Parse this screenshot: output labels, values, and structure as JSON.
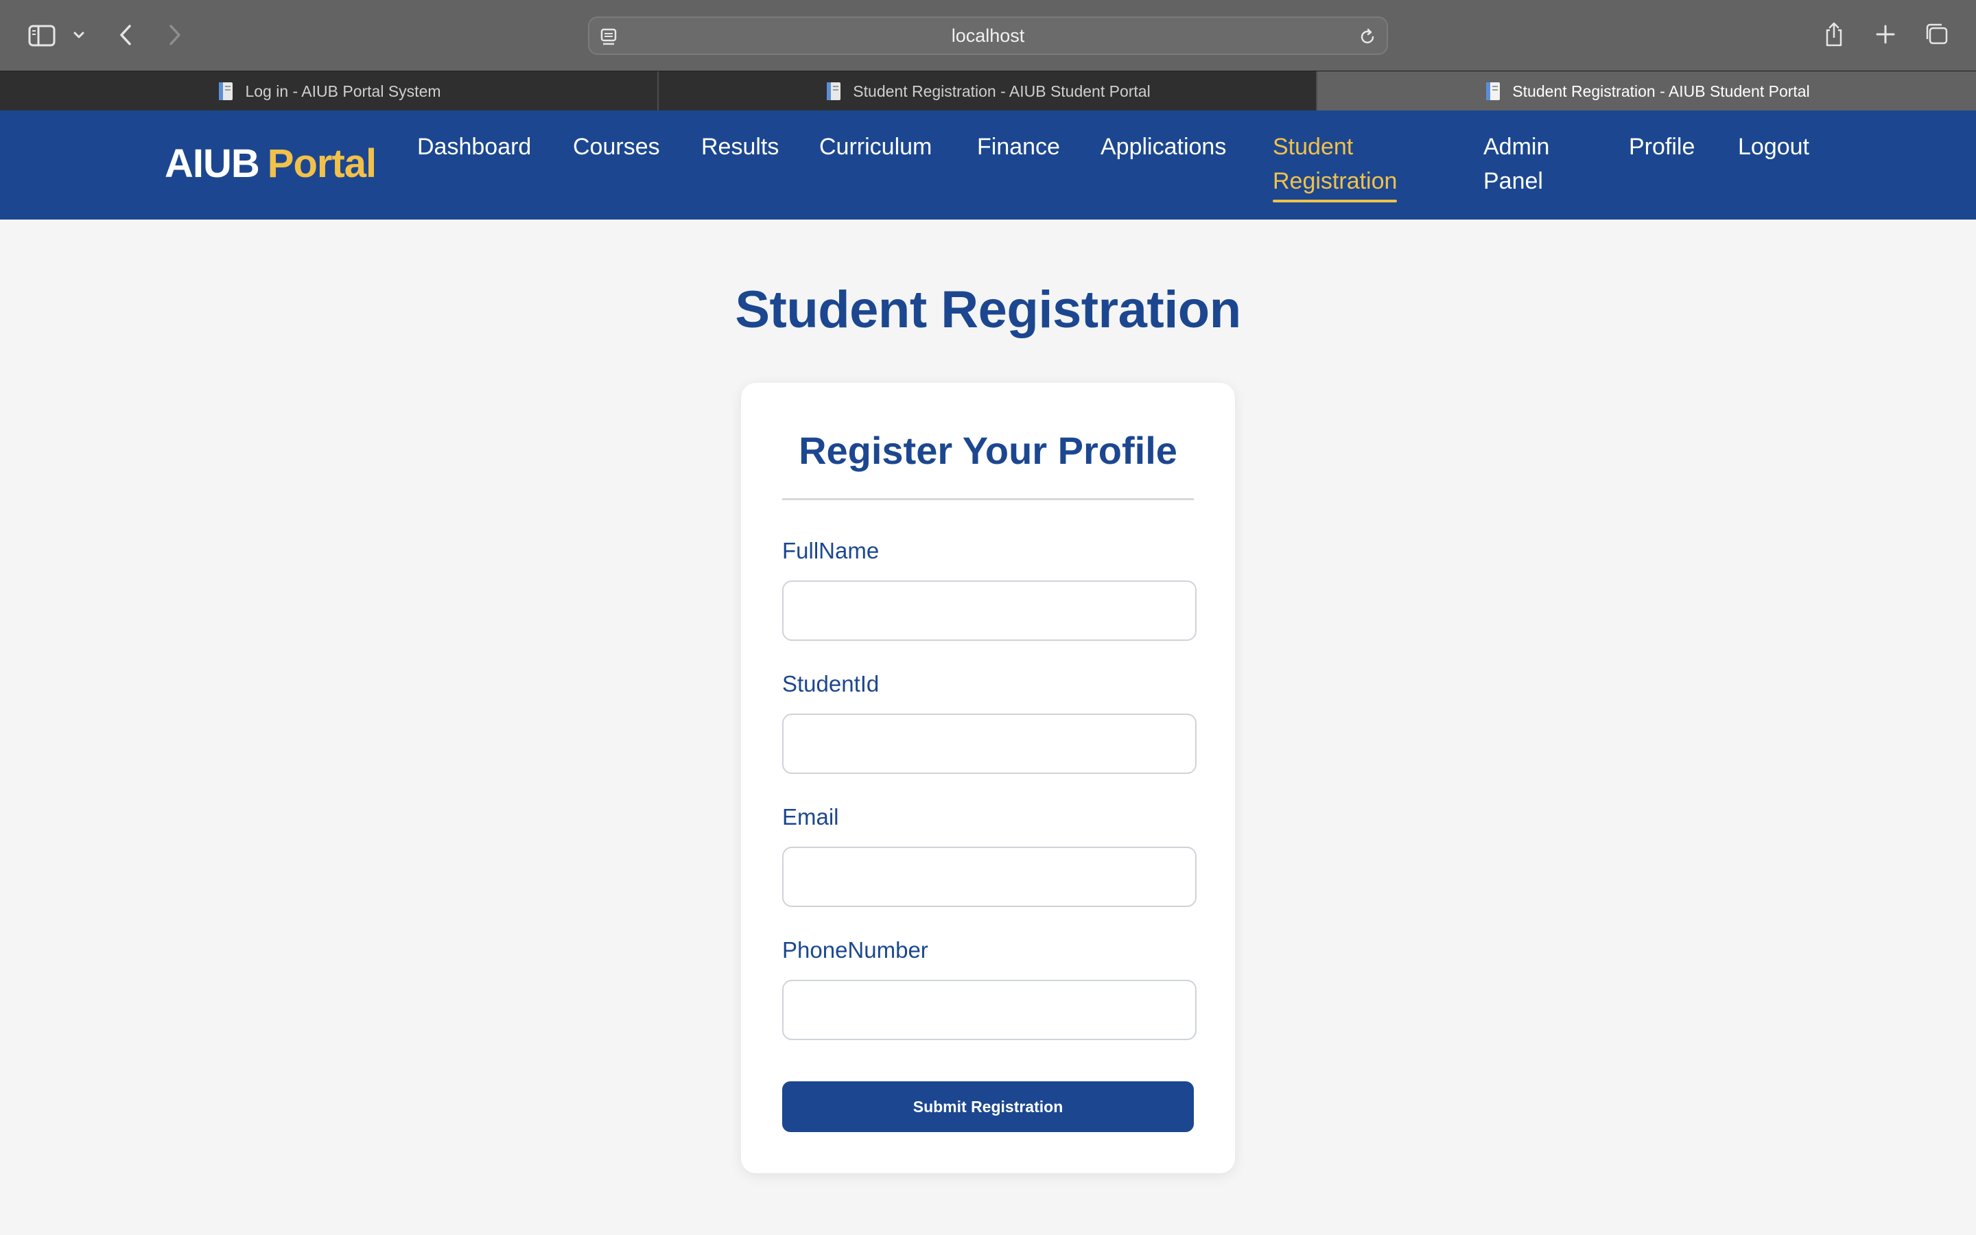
{
  "browser": {
    "url": "localhost",
    "tabs": [
      {
        "title": "Log in - AIUB Portal System",
        "active": false
      },
      {
        "title": "Student Registration - AIUB Student Portal",
        "active": false
      },
      {
        "title": "Student Registration - AIUB Student Portal",
        "active": true
      }
    ],
    "icons": [
      "sidebar-icon",
      "chevron-down-icon",
      "back-icon",
      "forward-icon",
      "page-icon",
      "reload-icon",
      "share-icon",
      "new-tab-icon",
      "tab-overview-icon"
    ]
  },
  "header": {
    "logo": {
      "part1": "AIUB",
      "part2": "Portal"
    },
    "nav": [
      {
        "line1": "Dashboard",
        "line2": ""
      },
      {
        "line1": "Courses",
        "line2": ""
      },
      {
        "line1": "Results",
        "line2": ""
      },
      {
        "line1": "Curriculum",
        "line2": ""
      },
      {
        "line1": "Finance",
        "line2": ""
      },
      {
        "line1": "Applications",
        "line2": ""
      },
      {
        "line1": "Student",
        "line2": "Registration"
      },
      {
        "line1": "Admin",
        "line2": "Panel"
      },
      {
        "line1": "Profile",
        "line2": ""
      },
      {
        "line1": "Logout",
        "line2": ""
      }
    ],
    "active_nav": "Student Registration"
  },
  "main": {
    "page_title": "Student Registration",
    "form": {
      "title": "Register Your Profile",
      "fields": [
        {
          "label": "FullName",
          "value": "",
          "placeholder": ""
        },
        {
          "label": "StudentId",
          "value": "",
          "placeholder": ""
        },
        {
          "label": "Email",
          "value": "",
          "placeholder": ""
        },
        {
          "label": "PhoneNumber",
          "value": "",
          "placeholder": ""
        }
      ],
      "submit_label": "Submit Registration"
    }
  },
  "colors": {
    "brand_blue": "#1c4790",
    "accent_gold": "#f2c14a",
    "page_bg": "#f4f5f4",
    "chrome_gray": "#636363"
  }
}
